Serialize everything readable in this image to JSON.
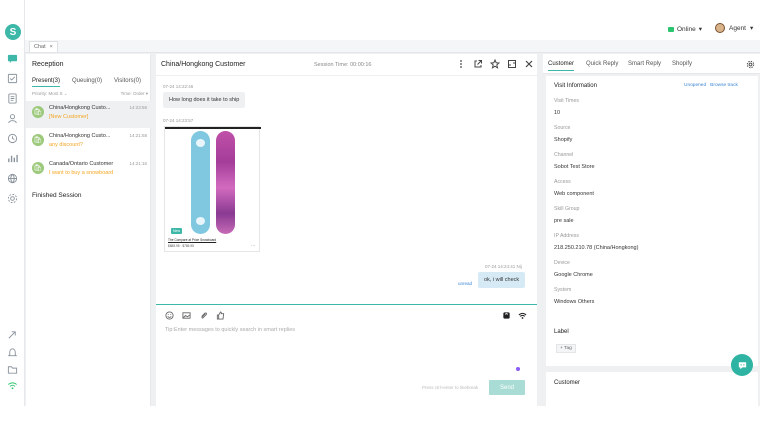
{
  "app": {
    "logo": "S"
  },
  "header": {
    "status": "Online",
    "agent": "Agent"
  },
  "tabs": {
    "chat_tab": "Chat"
  },
  "reception": {
    "title": "Reception",
    "tabs": [
      "Present(3)",
      "Queuing(0)",
      "Visitors(0)"
    ],
    "filter_left": "Priority: Most S ⌄",
    "filter_right": "Time: Order ▾",
    "sessions": [
      {
        "name": "China/Hongkong Custo...",
        "time": "14:23:56",
        "message": "[New Customer]"
      },
      {
        "name": "China/Hongkong Custo...",
        "time": "14:21:58",
        "message": "any discount?"
      },
      {
        "name": "Canada/Ontario Customer",
        "time": "14:21:16",
        "message": "I want to buy a snowboard"
      }
    ],
    "finished": "Finished Session"
  },
  "chat": {
    "customer": "China/Hongkong Customer",
    "session_time": "Session Time: 00:00:16",
    "msg1_time": "07-24 14:22:46",
    "msg1": "How long does it take to ship",
    "msg2_time": "07-24 14:23:57",
    "product": {
      "tag": "New",
      "title": "The Compare at Price Snowboard",
      "price": "$885.95 · $785.95",
      "more": "⋯"
    },
    "reply_time": "07-24 14:24:41 Nij",
    "reply": "ok, i will check",
    "unread": "unread",
    "tip": "Tip:Enter messages to quickly search in smart replies",
    "hint": "Press ctrl+enter to linebreak",
    "send": "Send"
  },
  "right": {
    "tabs": [
      "Customer",
      "Quick Reply",
      "Smart Reply",
      "Shopify"
    ],
    "visit_title": "Visit Information",
    "links": [
      "Unopened",
      "Browse track"
    ],
    "fields": [
      {
        "label": "Visit Times",
        "value": "10"
      },
      {
        "label": "Source",
        "value": "Shopify"
      },
      {
        "label": "Channel",
        "value": "Sobot Test Store"
      },
      {
        "label": "Access",
        "value": "Web component"
      },
      {
        "label": "Skill Group",
        "value": "pre sale"
      },
      {
        "label": "IP Address",
        "value": "218.250.210.78 (China/Hongkong)"
      },
      {
        "label": "Device",
        "value": "Google Chrome"
      },
      {
        "label": "System",
        "value": "Windows Others"
      }
    ],
    "label_title": "Label",
    "tag_btn": "+ Tag",
    "customer_title": "Customer"
  },
  "colors": {
    "accent": "#3cb7a8",
    "warning": "#f5a623",
    "link": "#3b86d6",
    "online": "#2cc56f"
  }
}
